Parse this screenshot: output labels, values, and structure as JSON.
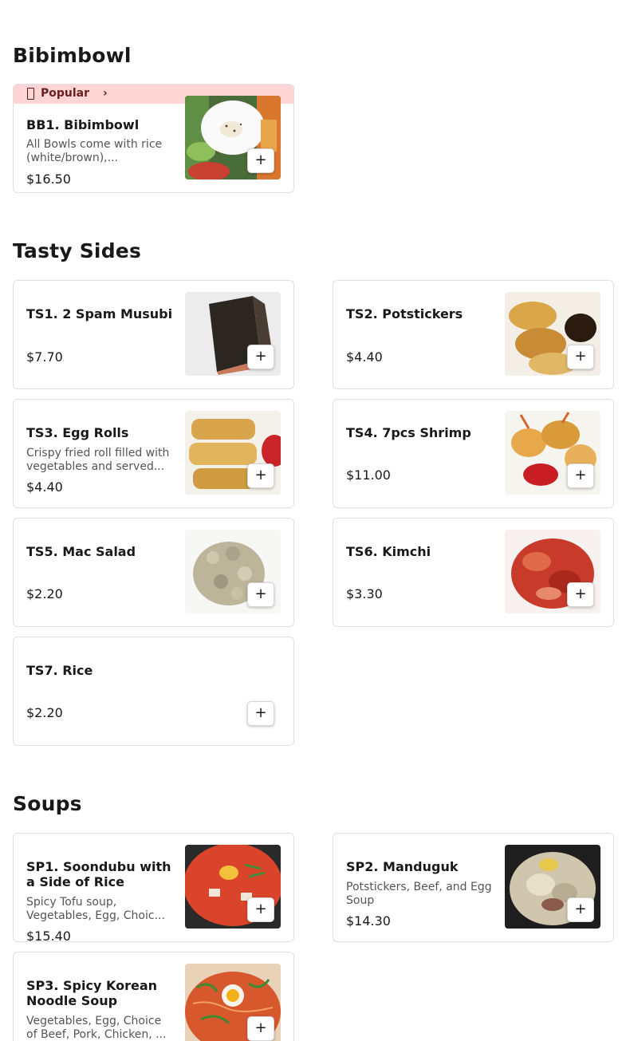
{
  "sections": [
    {
      "title": "Bibimbowl",
      "items": [
        {
          "badge": "Popular",
          "name": "BB1. Bibimbowl",
          "description": "All Bowls come with rice (white/brown),...",
          "price": "$16.50",
          "image": "bibimbowl-photo"
        }
      ]
    },
    {
      "title": "Tasty Sides",
      "items": [
        {
          "name": "TS1. 2 Spam Musubi",
          "description": "",
          "price": "$7.70",
          "image": "spam-musubi-photo"
        },
        {
          "name": "TS2. Potstickers",
          "description": "",
          "price": "$4.40",
          "image": "potstickers-photo"
        },
        {
          "name": "TS3. Egg Rolls",
          "description": "Crispy fried roll filled with vegetables and served...",
          "price": "$4.40",
          "image": "egg-rolls-photo"
        },
        {
          "name": "TS4. 7pcs Shrimp",
          "description": "",
          "price": "$11.00",
          "image": "shrimp-photo"
        },
        {
          "name": "TS5. Mac Salad",
          "description": "",
          "price": "$2.20",
          "image": "mac-salad-photo"
        },
        {
          "name": "TS6. Kimchi",
          "description": "",
          "price": "$3.30",
          "image": "kimchi-photo"
        },
        {
          "name": "TS7. Rice",
          "description": "",
          "price": "$2.20",
          "image": ""
        }
      ]
    },
    {
      "title": "Soups",
      "items": [
        {
          "name": "SP1. Soondubu with a Side of Rice",
          "description": "Spicy Tofu soup, Vegetables, Egg, Choic...",
          "price": "$15.40",
          "image": "soondubu-photo"
        },
        {
          "name": "SP2. Manduguk",
          "description": "Potstickers, Beef, and Egg Soup",
          "price": "$14.30",
          "image": "manduguk-photo"
        },
        {
          "name": "SP3. Spicy Korean Noodle Soup",
          "description": "Vegetables, Egg, Choice of Beef, Pork, Chicken, ...",
          "price": "",
          "image": "noodle-soup-photo"
        }
      ]
    }
  ],
  "add_button_label": "+",
  "colors": {
    "popular_bg": "#fed4d4",
    "popular_text": "#6a1f1f",
    "card_border": "#e0e0e0"
  }
}
